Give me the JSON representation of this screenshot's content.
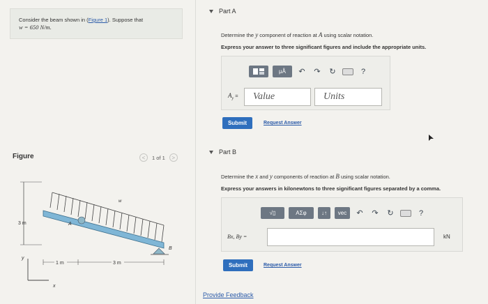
{
  "problem": {
    "text_pre": "Consider the beam shown in (",
    "link": "Figure 1",
    "text_mid": "). Suppose that",
    "w_expr": "w = 650 N/m."
  },
  "figure": {
    "label": "Figure",
    "pager": "1 of 1",
    "prev": "<",
    "next": ">",
    "dim_height": "3 m",
    "dim_left": "1 m",
    "dim_right": "3 m",
    "load": "w",
    "point_a": "A",
    "point_b": "B",
    "axis_x": "x",
    "axis_y": "y"
  },
  "partA": {
    "title": "Part A",
    "question_pre": "Determine the",
    "question_var": "y",
    "question_mid": "component of reaction at",
    "question_point": "A",
    "question_post": "using scalar notation.",
    "instruction": "Express your answer to three significant figures and include the appropriate units.",
    "toolbar_mu": "μÅ",
    "help": "?",
    "label": "A",
    "label_sub": "y",
    "label_eq": "=",
    "value_placeholder": "Value",
    "units_placeholder": "Units",
    "submit": "Submit",
    "request": "Request Answer"
  },
  "partB": {
    "title": "Part B",
    "question_pre": "Determine the",
    "question_x": "x",
    "question_and": "and",
    "question_y": "y",
    "question_mid": "components of reaction at",
    "question_point": "B",
    "question_post": "using scalar notation.",
    "instruction": "Express your answers in kilonewtons to three significant figures separated by a comma.",
    "toolbar_sqrt": "√▯",
    "toolbar_greek": "ΑΣφ",
    "toolbar_arrows": "↓↑",
    "toolbar_vec": "vec",
    "help": "?",
    "label": "Bx, By =",
    "unit": "kN",
    "submit": "Submit",
    "request": "Request Answer"
  },
  "feedback": "Provide Feedback",
  "colors": {
    "accent": "#2f6fbd",
    "link": "#2a5aa8",
    "beam": "#7fb6d6"
  }
}
